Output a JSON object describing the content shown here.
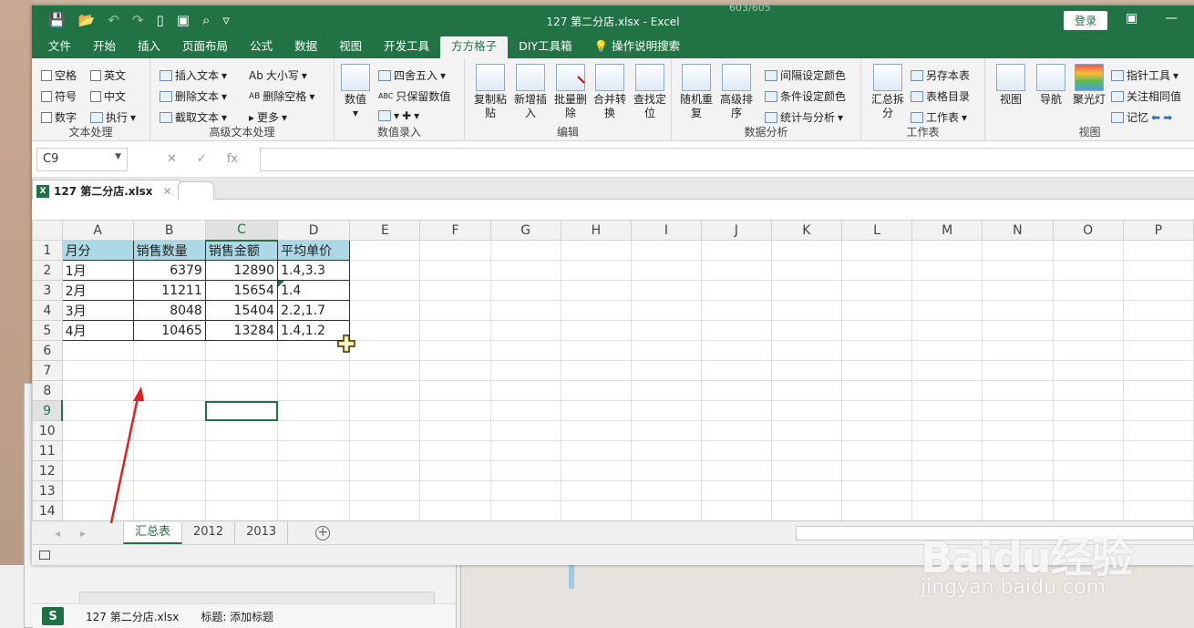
{
  "window": {
    "title": "127 第二分店.xlsx - Excel",
    "counter": "603/605",
    "login": "登录"
  },
  "ribbon_tabs": [
    "文件",
    "开始",
    "插入",
    "页面布局",
    "公式",
    "数据",
    "视图",
    "开发工具",
    "方方格子",
    "DIY工具箱",
    "操作说明搜索"
  ],
  "active_tab": "方方格子",
  "ribbon": {
    "text_group": {
      "label": "文本处理",
      "items": [
        "空格",
        "英文",
        "符号",
        "中文",
        "数字",
        "执行"
      ]
    },
    "adv_text_group": {
      "label": "高级文本处理",
      "items": [
        "插入文本",
        "大小写",
        "删除文本",
        "删除空格",
        "截取文本",
        "更多"
      ]
    },
    "value_group": {
      "label": "数值录入",
      "big": "数值",
      "items": [
        "四舍五入",
        "只保留数值"
      ]
    },
    "edit_group": {
      "label": "编辑",
      "buttons": [
        "复制粘贴",
        "新增插入",
        "批量删除",
        "合并转换",
        "查找定位"
      ]
    },
    "analysis_group": {
      "label": "数据分析",
      "buttons": [
        "随机重复",
        "高级排序"
      ],
      "items": [
        "间隔设定颜色",
        "条件设定颜色",
        "统计与分析"
      ]
    },
    "sheet_group": {
      "label": "工作表",
      "big": "汇总拆分",
      "items": [
        "另存本表",
        "表格目录",
        "工作表"
      ]
    },
    "view_group": {
      "label": "视图",
      "buttons": [
        "视图",
        "导航",
        "聚光灯"
      ],
      "items": [
        "指针工具",
        "关注相同值",
        "记忆"
      ]
    }
  },
  "formula_bar": {
    "name_box": "C9",
    "fx": "fx",
    "value": ""
  },
  "doc_tab": "127 第二分店.xlsx",
  "columns": [
    "A",
    "B",
    "C",
    "D",
    "E",
    "F",
    "G",
    "H",
    "I",
    "J",
    "K",
    "L",
    "M",
    "N",
    "O",
    "P"
  ],
  "selected_col": "C",
  "rows": [
    "1",
    "2",
    "3",
    "4",
    "5",
    "6",
    "7",
    "8",
    "9",
    "10",
    "11",
    "12",
    "13",
    "14"
  ],
  "selected_row": "9",
  "table": {
    "header": [
      "月分",
      "销售数量",
      "销售金额",
      "平均单价"
    ],
    "rows": [
      [
        "1月",
        "6379",
        "12890",
        "1.4,3.3"
      ],
      [
        "2月",
        "11211",
        "15654",
        "1.4"
      ],
      [
        "3月",
        "8048",
        "15404",
        "2.2,1.7"
      ],
      [
        "4月",
        "10465",
        "13284",
        "1.4,1.2"
      ]
    ]
  },
  "sheets": [
    "汇总表",
    "2012",
    "2013"
  ],
  "active_sheet": "汇总表",
  "background_file": {
    "name": "127 第二分店.xlsx",
    "title_label": "标题: 添加标题"
  },
  "watermark": {
    "brand": "Baidu经验",
    "url": "jingyan.baidu.com"
  },
  "colors": {
    "excel_green": "#217346",
    "header_fill": "#add8e6",
    "arrow": "#e02020"
  }
}
